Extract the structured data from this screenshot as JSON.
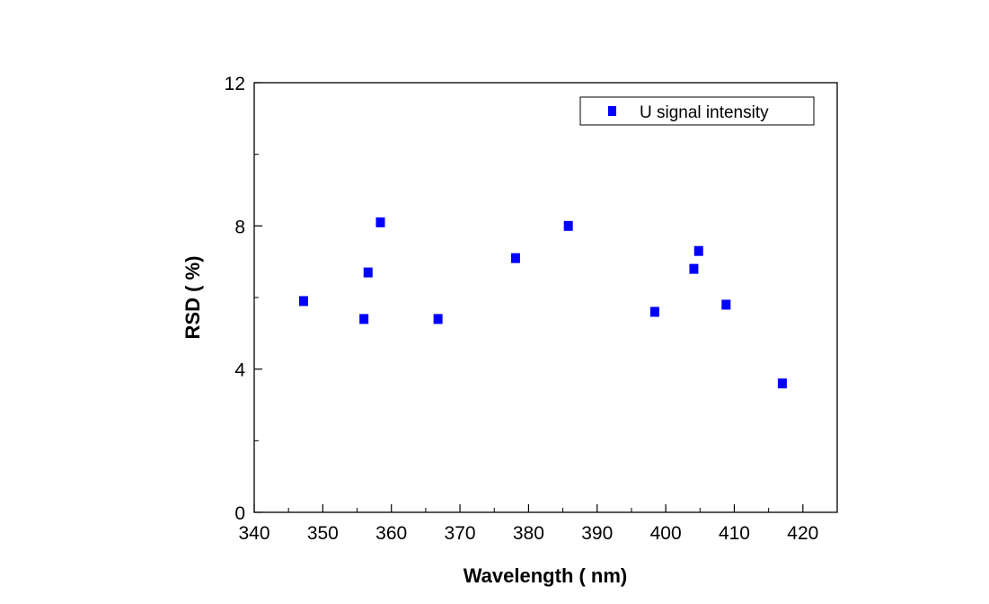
{
  "chart_data": {
    "type": "scatter",
    "title": "",
    "xlabel": "Wavelength ( nm)",
    "ylabel": "RSD ( %)",
    "xlim": [
      340,
      425
    ],
    "ylim": [
      0,
      12
    ],
    "xticks": [
      340,
      350,
      360,
      370,
      380,
      390,
      400,
      410,
      420
    ],
    "yticks": [
      0,
      4,
      8,
      12
    ],
    "grid": false,
    "legend_position": "top-right",
    "series": [
      {
        "name": "U signal intensity",
        "color": "#0000ff",
        "marker": "square",
        "x": [
          347.2,
          356.0,
          356.6,
          358.4,
          366.8,
          378.1,
          385.8,
          398.4,
          404.1,
          404.8,
          408.8,
          417.0
        ],
        "y": [
          5.9,
          5.4,
          6.7,
          8.1,
          5.4,
          7.1,
          8.0,
          5.6,
          6.8,
          7.3,
          5.8,
          3.6
        ]
      }
    ]
  }
}
